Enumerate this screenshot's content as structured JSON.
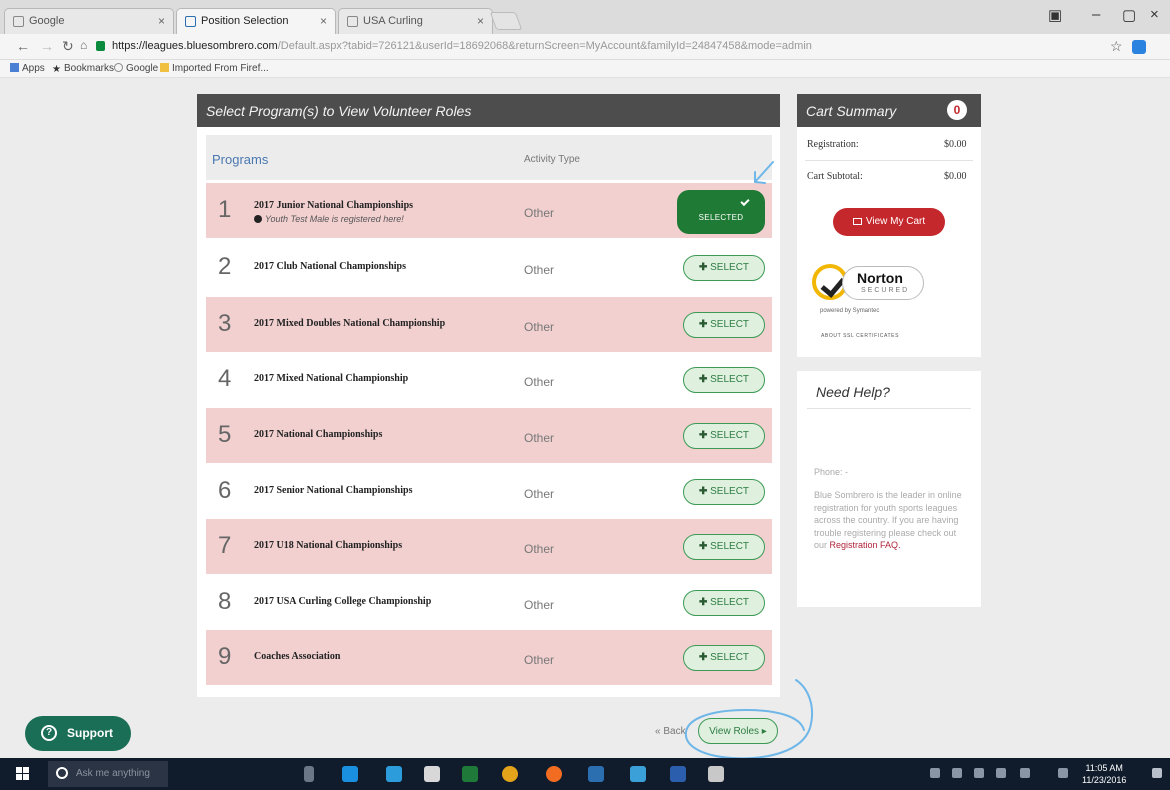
{
  "browser": {
    "tabs": [
      {
        "label": "Google"
      },
      {
        "label": "Position Selection"
      },
      {
        "label": "USA Curling"
      }
    ],
    "url_host": "https://leagues.bluesombrero.com",
    "url_path": "/Default.aspx?tabid=726121&userId=18692068&returnScreen=MyAccount&familyId=24847458&mode=admin",
    "bookmarks": [
      "Apps",
      "Bookmarks",
      "Google",
      "Imported From Firef..."
    ]
  },
  "programs_panel": {
    "header": "Select Program(s) to View Volunteer Roles",
    "col_programs": "Programs",
    "col_activity": "Activity Type",
    "rows": [
      {
        "num": "1",
        "name": "2017 Junior National Championships",
        "note": "Youth Test Male is registered here!",
        "type": "Other",
        "button": "SELECTED",
        "selected": true
      },
      {
        "num": "2",
        "name": "2017 Club National Championships",
        "type": "Other",
        "button": "SELECT"
      },
      {
        "num": "3",
        "name": "2017 Mixed Doubles National Championship",
        "type": "Other",
        "button": "SELECT"
      },
      {
        "num": "4",
        "name": "2017 Mixed National Championship",
        "type": "Other",
        "button": "SELECT"
      },
      {
        "num": "5",
        "name": "2017 National Championships",
        "type": "Other",
        "button": "SELECT"
      },
      {
        "num": "6",
        "name": "2017 Senior National Championships",
        "type": "Other",
        "button": "SELECT"
      },
      {
        "num": "7",
        "name": "2017 U18 National Championships",
        "type": "Other",
        "button": "SELECT"
      },
      {
        "num": "8",
        "name": "2017 USA Curling College Championship",
        "type": "Other",
        "button": "SELECT"
      },
      {
        "num": "9",
        "name": "Coaches Association",
        "type": "Other",
        "button": "SELECT"
      }
    ],
    "back_label": "« Back",
    "view_roles_label": "View Roles ▸"
  },
  "cart": {
    "title": "Cart Summary",
    "count": "0",
    "registration_label": "Registration:",
    "registration_value": "$0.00",
    "subtotal_label": "Cart Subtotal:",
    "subtotal_value": "$0.00",
    "view_cart_label": "View My Cart",
    "norton_name": "Norton",
    "norton_secured": "SECURED",
    "norton_powered": "powered by Symantec",
    "norton_about": "ABOUT SSL CERTIFICATES"
  },
  "help": {
    "title": "Need Help?",
    "phone": "Phone: -",
    "text": "Blue Sombrero is the leader in online registration for youth sports leagues across the country. If you are having trouble registering please check out our ",
    "faq": "Registration FAQ."
  },
  "support_label": "Support",
  "taskbar": {
    "search_placeholder": "Ask me anything",
    "time": "11:05 AM",
    "date": "11/23/2016"
  },
  "colors": {
    "row_alt": "#f2d0d0",
    "header_dark": "#4d4d4d",
    "selected_green": "#1f7a35",
    "select_border": "#3c9a55",
    "cart_red": "#c5282c",
    "support_green": "#1a6e55",
    "annotation_blue": "#6fb7e8"
  }
}
